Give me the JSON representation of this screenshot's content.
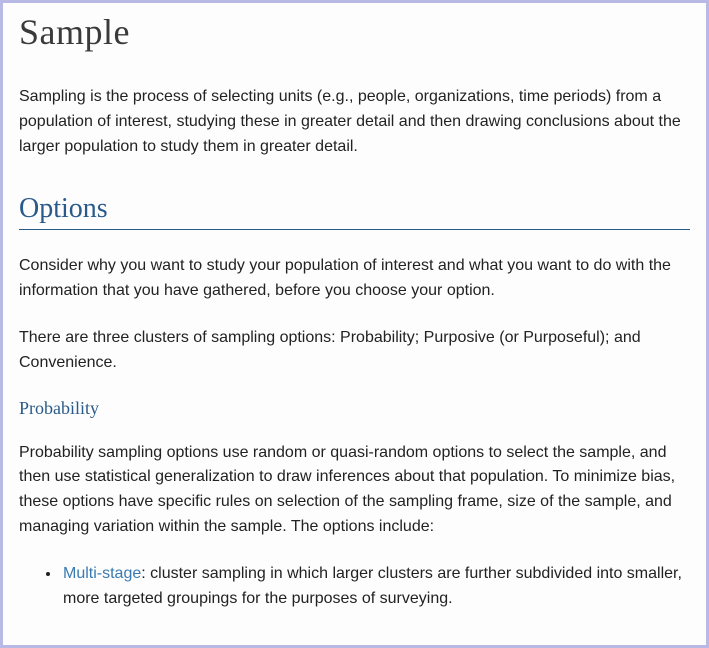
{
  "title": "Sample",
  "intro": "Sampling is the process of selecting units (e.g., people, organizations, time periods) from a population of interest, studying these in greater detail and then drawing conclusions about the larger population to study them in greater detail.",
  "options": {
    "heading": "Options",
    "p1": "Consider why you want to study your population of interest and what you want to do with the information that you have gathered, before you choose your option.",
    "p2": "There are three clusters of sampling options: Probability; Purposive (or Purposeful); and Convenience.",
    "probability": {
      "heading": "Probability",
      "p1": "Probability sampling options use random or quasi-random options to select the sample, and then use statistical generalization to draw inferences about that population. To minimize bias, these options have specific rules on selection of the sampling frame, size of the sample, and managing variation within the sample. The options include:",
      "items": [
        {
          "link_label": "Multi-stage",
          "desc": ": cluster sampling in which larger clusters are further subdivided into smaller, more targeted groupings for the purposes of surveying."
        }
      ]
    }
  }
}
